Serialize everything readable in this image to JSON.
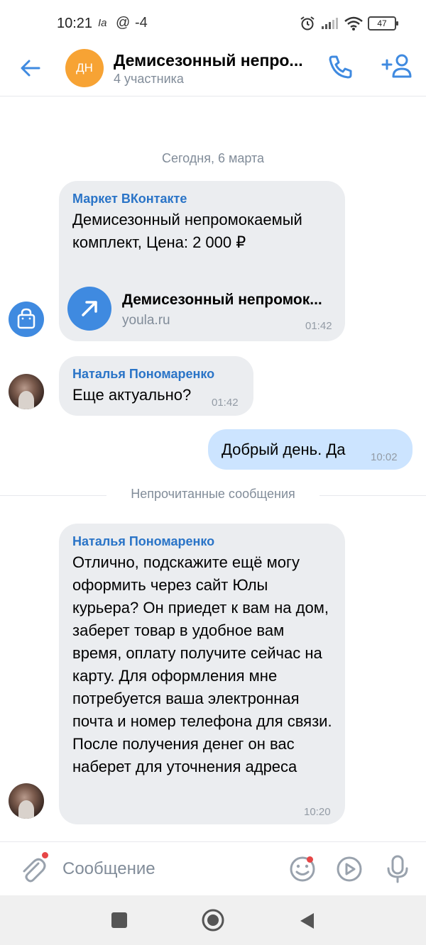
{
  "status_bar": {
    "time": "10:21",
    "extra": "Ia",
    "at_icon": "at-icon",
    "temp": "-4",
    "battery": "47"
  },
  "header": {
    "avatar_initials": "ДН",
    "title": "Демисезонный непро...",
    "subtitle": "4 участника",
    "colors": {
      "accent": "#3f8ae0",
      "avatar": "#f7a334"
    }
  },
  "chat": {
    "date_separator": "Сегодня, 6 марта",
    "unread_label": "Непрочитанные сообщения",
    "messages": [
      {
        "sender": "Маркет ВКонтакте",
        "text": "Демисезонный непромокаемый комплект, Цена: 2 000 ₽",
        "link": {
          "title": "Демисезонный непромок...",
          "domain": "youla.ru"
        },
        "time": "01:42"
      },
      {
        "sender": "Наталья Пономаренко",
        "text": "Еще актуально?",
        "time": "01:42"
      },
      {
        "sender": "",
        "text": "Добрый день. Да",
        "time": "10:02",
        "outgoing": true
      },
      {
        "sender": "Наталья Пономаренко",
        "text": "Отлично, подскажите ещё могу оформить через сайт Юлы курьера? Он приедет к вам на дом, заберет товар в удобное вам время, оплату получите сейчас на карту. Для оформления мне потребуется ваша электронная почта и номер телефона для связи. После получения денег он вас наберет для уточнения адреса",
        "time": "10:20"
      }
    ]
  },
  "composer": {
    "placeholder": "Сообщение"
  },
  "icons": {
    "back": "arrow-left-icon",
    "call": "phone-icon",
    "add_member": "add-user-icon",
    "attach": "paperclip-icon",
    "emoji": "smile-icon",
    "video": "play-circle-icon",
    "mic": "microphone-icon"
  }
}
